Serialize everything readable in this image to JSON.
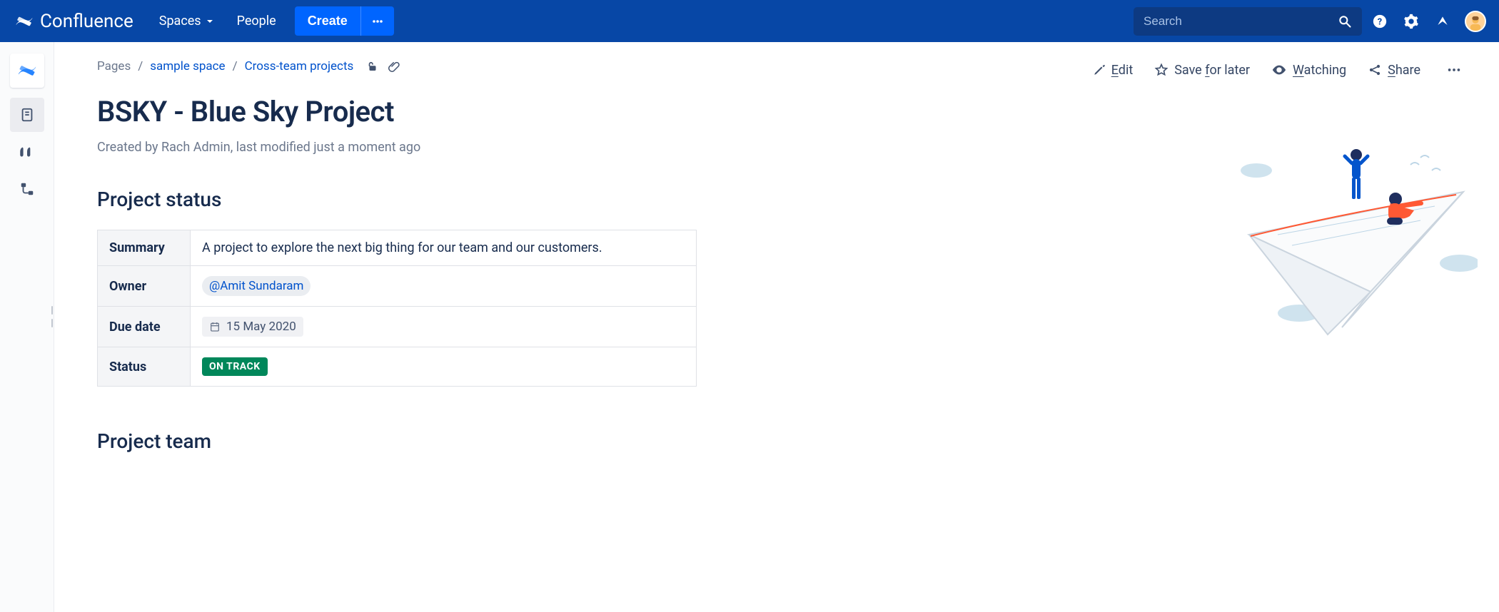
{
  "header": {
    "product": "Confluence",
    "spaces": "Spaces",
    "people": "People",
    "create": "Create",
    "search_placeholder": "Search"
  },
  "breadcrumb": {
    "root": "Pages",
    "space": "sample space",
    "parent": "Cross-team projects"
  },
  "page": {
    "title": "BSKY - Blue Sky Project",
    "byline": "Created by Rach Admin, last modified just a moment ago"
  },
  "actions": {
    "edit_prefix": "E",
    "edit_rest": "dit",
    "save_prefix": "Save ",
    "save_u": "f",
    "save_rest": "or later",
    "watch_prefix": "W",
    "watch_rest": "atching",
    "share_prefix": "S",
    "share_rest": "hare"
  },
  "sections": {
    "status_heading": "Project status",
    "team_heading": "Project team"
  },
  "status_table": {
    "summary_label": "Summary",
    "summary_value": "A project to explore the next big thing for our team and our customers.",
    "owner_label": "Owner",
    "owner_value": "@Amit Sundaram",
    "due_label": "Due date",
    "due_value": "15 May 2020",
    "status_label": "Status",
    "status_value": "ON TRACK"
  }
}
